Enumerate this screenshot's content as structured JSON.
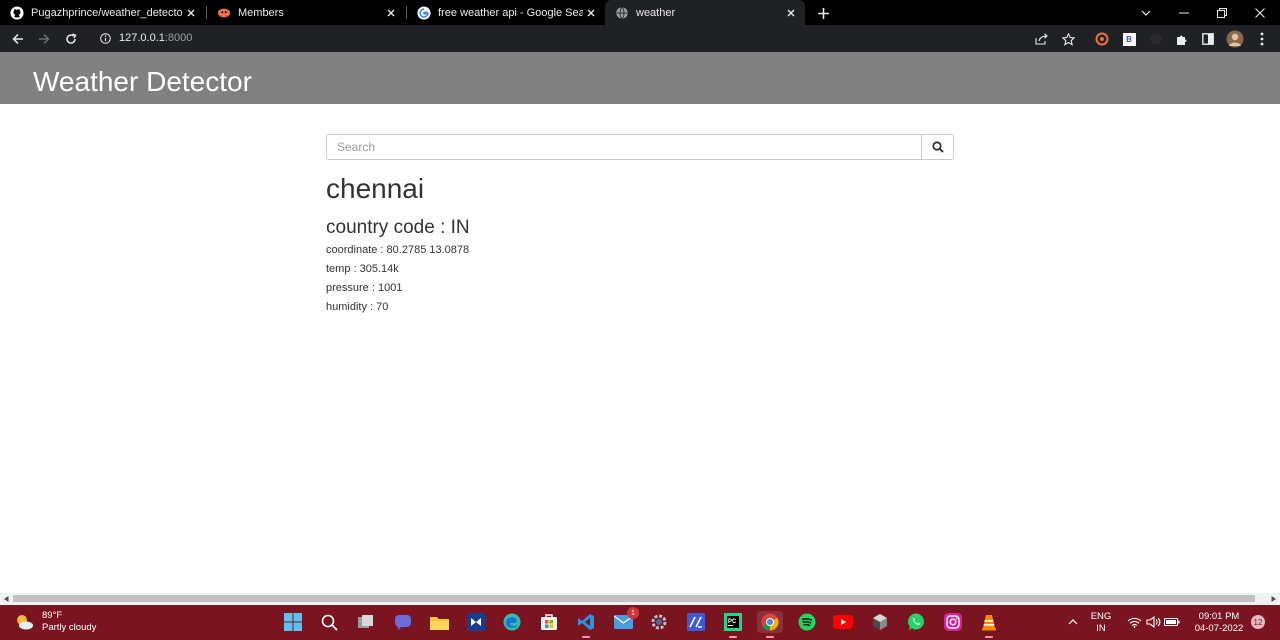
{
  "browser": {
    "tabs": [
      {
        "title": "Pugazhprince/weather_detector:",
        "icon": "github-icon"
      },
      {
        "title": "Members",
        "icon": "members-icon"
      },
      {
        "title": "free weather api - Google Search",
        "icon": "google-icon"
      },
      {
        "title": "weather",
        "icon": "globe-icon",
        "active": true
      }
    ],
    "url_host": "127.0.0.1",
    "url_port": ":8000",
    "extension_label": "B"
  },
  "header": {
    "brand": "Weather Detector"
  },
  "search": {
    "placeholder": "Search"
  },
  "result": {
    "city": "chennai",
    "country_label": "country code",
    "country_value": "IN",
    "details": [
      {
        "label": "coordinate",
        "value": "80.2785 13.0878"
      },
      {
        "label": "temp",
        "value": "305.14k"
      },
      {
        "label": "pressure",
        "value": "1001"
      },
      {
        "label": "humidity",
        "value": "70"
      }
    ]
  },
  "taskbar": {
    "weather_temp": "89°F",
    "weather_desc": "Partly cloudy",
    "mail_badge": "1",
    "lang": "ENG",
    "region": "IN",
    "time": "09:01 PM",
    "date": "04-07-2022",
    "notifications": "12"
  },
  "colors": {
    "header_bg": "#808080",
    "taskbar_bg": "#7a1420",
    "tabbar_bg": "#000000",
    "toolbar_bg": "#202124"
  }
}
